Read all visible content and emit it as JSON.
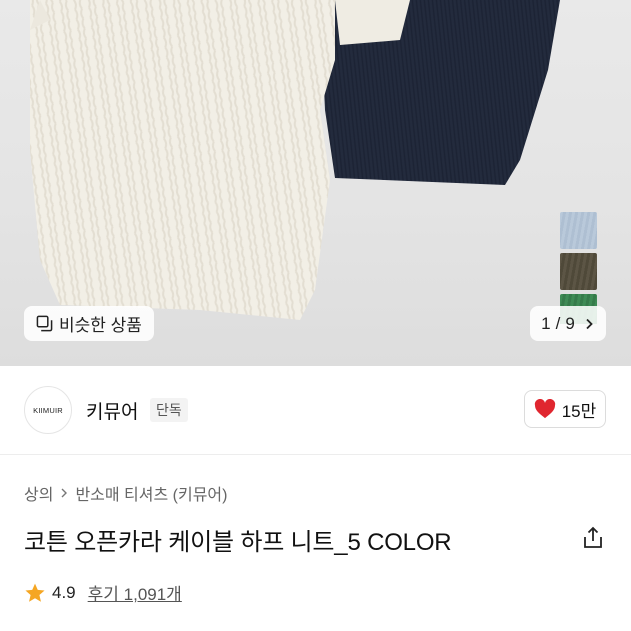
{
  "gallery": {
    "similar_label": "비슷한 상품",
    "page_current": "1",
    "page_separator": "/",
    "page_total": "9",
    "swatch_colors": [
      "#b9c9da",
      "#5c5545",
      "#3e8b55"
    ]
  },
  "shop": {
    "logo_text": "KIIMUIR",
    "name": "키뮤어",
    "badge": "단독",
    "likes": "15만"
  },
  "breadcrumb": {
    "category": "상의",
    "subcategory": "반소매 티셔츠 (키뮤어)"
  },
  "product": {
    "title": "코튼 오픈카라 케이블 하프 니트_5 COLOR",
    "rating": "4.9",
    "reviews": "후기 1,091개"
  },
  "colors": {
    "heart": "#e0262f",
    "star": "#f5a623"
  }
}
